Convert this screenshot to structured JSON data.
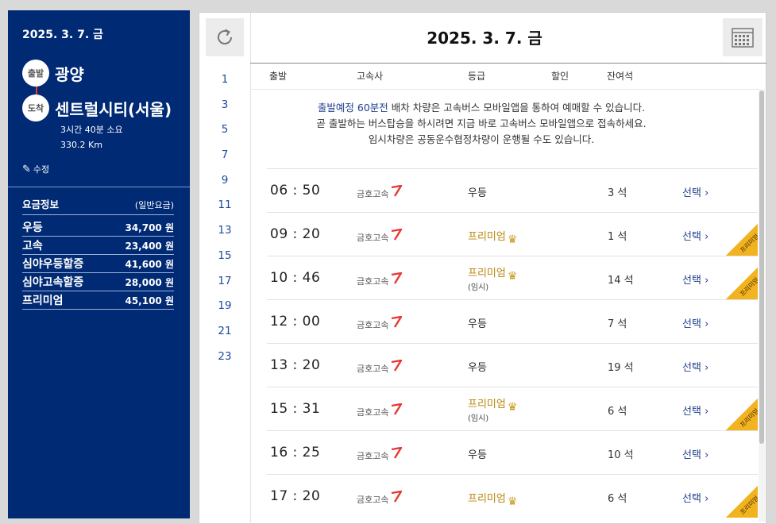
{
  "sidebar": {
    "date": "2025. 3. 7. 금",
    "departure": {
      "badge": "출발",
      "name": "광양"
    },
    "arrival": {
      "badge": "도착",
      "name": "센트럴시티(서울)"
    },
    "duration": "3시간 40분 소요",
    "distance": "330.2 Km",
    "edit_label": "수정",
    "fare_title": "요금정보",
    "fare_subtitle": "(일반요금)",
    "fares": [
      {
        "label": "우등",
        "value": "34,700 원"
      },
      {
        "label": "고속",
        "value": "23,400 원"
      },
      {
        "label": "심야우등할증",
        "value": "41,600 원"
      },
      {
        "label": "심야고속할증",
        "value": "28,000 원"
      },
      {
        "label": "프리미엄",
        "value": "45,100 원"
      }
    ]
  },
  "main": {
    "title": "2025. 3. 7. 금",
    "hours": [
      "1",
      "3",
      "5",
      "7",
      "9",
      "11",
      "13",
      "15",
      "17",
      "19",
      "21",
      "23"
    ],
    "columns": {
      "depart": "출발",
      "company": "고속사",
      "grade": "등급",
      "discount": "할인",
      "seats": "잔여석"
    },
    "notice": {
      "highlight": "출발예정 60분전",
      "line1": " 배차 차량은 고속버스 모바일앱을 통하여 예매할 수 있습니다.",
      "line2": "곧 출발하는 버스탑승을 하시려면 지금 바로 고속버스 모바일앱으로 접속하세요.",
      "line3": "임시차량은 공동운수협정차량이 운행될 수도 있습니다."
    },
    "rows": [
      {
        "time": "06 : 50",
        "company": "금호고속",
        "grade": "우등",
        "temp": "",
        "seats": "3 석",
        "select": "선택",
        "premium": false
      },
      {
        "time": "09 : 20",
        "company": "금호고속",
        "grade": "프리미엄",
        "temp": "",
        "seats": "1 석",
        "select": "선택",
        "premium": true
      },
      {
        "time": "10 : 46",
        "company": "금호고속",
        "grade": "프리미엄",
        "temp": "(임시)",
        "seats": "14 석",
        "select": "선택",
        "premium": true
      },
      {
        "time": "12 : 00",
        "company": "금호고속",
        "grade": "우등",
        "temp": "",
        "seats": "7 석",
        "select": "선택",
        "premium": false
      },
      {
        "time": "13 : 20",
        "company": "금호고속",
        "grade": "우등",
        "temp": "",
        "seats": "19 석",
        "select": "선택",
        "premium": false
      },
      {
        "time": "15 : 31",
        "company": "금호고속",
        "grade": "프리미엄",
        "temp": "(임시)",
        "seats": "6 석",
        "select": "선택",
        "premium": true
      },
      {
        "time": "16 : 25",
        "company": "금호고속",
        "grade": "우등",
        "temp": "",
        "seats": "10 석",
        "select": "선택",
        "premium": false
      },
      {
        "time": "17 : 20",
        "company": "금호고속",
        "grade": "프리미엄",
        "temp": "",
        "seats": "6 석",
        "select": "선택",
        "premium": true
      }
    ],
    "ribbon_label": "프리미엄"
  },
  "colors": {
    "sidebar_bg": "#002a74",
    "link": "#1f3f8c",
    "premium": "#b8860b",
    "ribbon": "#f2b320",
    "kumho_red": "#e53935"
  },
  "icons": {
    "refresh": "refresh-icon",
    "calendar": "calendar-icon",
    "edit": "pencil-icon",
    "crown": "crown-icon",
    "chevron": "chevron-right-icon"
  }
}
